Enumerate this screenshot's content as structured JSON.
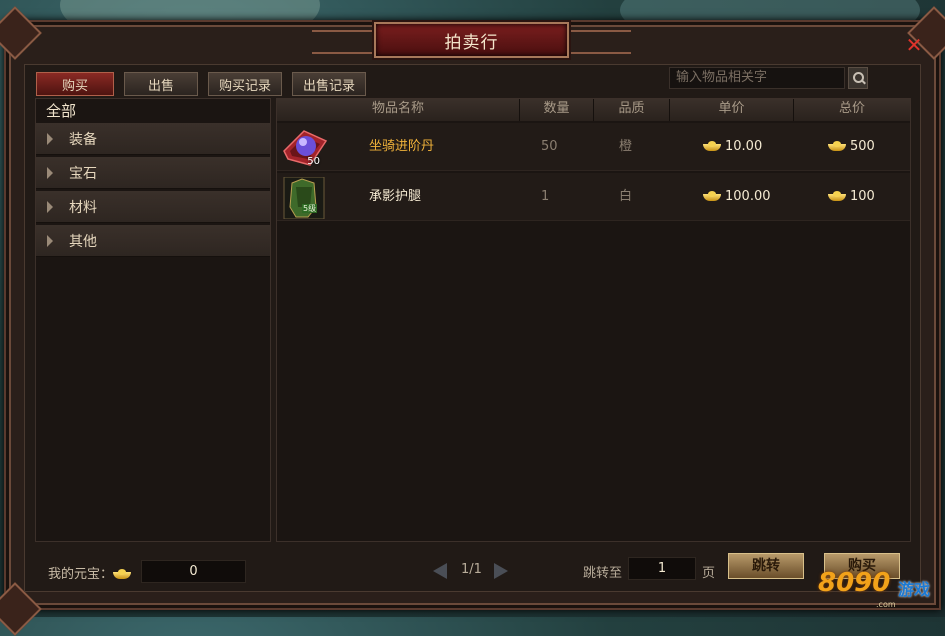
{
  "window": {
    "title": "拍卖行"
  },
  "tabs": [
    {
      "label": "购买",
      "active": true
    },
    {
      "label": "出售",
      "active": false
    },
    {
      "label": "购买记录",
      "active": false
    },
    {
      "label": "出售记录",
      "active": false
    }
  ],
  "search": {
    "placeholder": "输入物品相关字"
  },
  "categories": {
    "all_label": "全部",
    "items": [
      {
        "label": "装备"
      },
      {
        "label": "宝石"
      },
      {
        "label": "材料"
      },
      {
        "label": "其他"
      }
    ]
  },
  "table": {
    "headers": [
      "物品名称",
      "数量",
      "品质",
      "单价",
      "总价"
    ],
    "rows": [
      {
        "name": "坐骑进阶丹",
        "qty": "50",
        "quality": "橙",
        "unit_price": "10.00",
        "total": "500",
        "icon": "purple-orb-icon",
        "badge": "50",
        "name_color": "#f0b23a"
      },
      {
        "name": "承影护腿",
        "qty": "1",
        "quality": "白",
        "unit_price": "100.00",
        "total": "100",
        "icon": "leg-armor-icon",
        "badge": "5级",
        "name_color": "#f4ead2"
      }
    ]
  },
  "footer": {
    "balance_label": "我的元宝：",
    "balance_value": "0",
    "page": "1/1",
    "jump_label": "跳转至",
    "jump_value": "1",
    "page_unit": "页",
    "jump_button": "跳转",
    "buy_button": "购买"
  },
  "watermark": {
    "text": "8090",
    "sub": "游戏",
    "domain": ".com"
  },
  "colors": {
    "accent_red": "#7a1e1e",
    "gold": "#f0b23a"
  }
}
